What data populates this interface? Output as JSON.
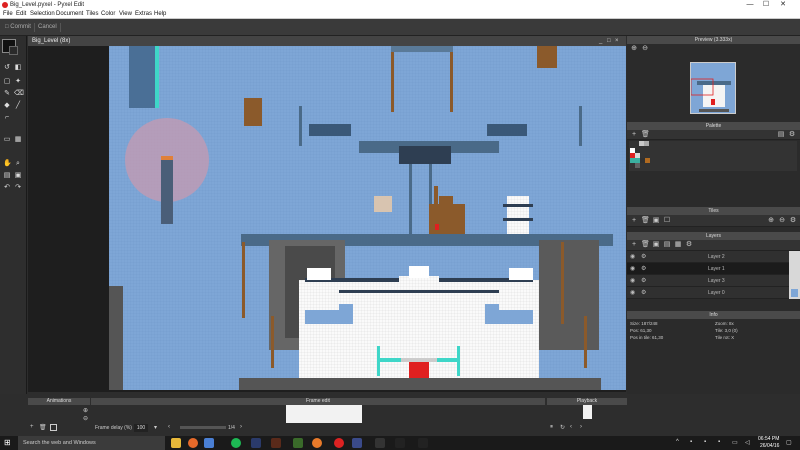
{
  "window": {
    "title": "Big_Level.pyxel - Pyxel Edit",
    "minimize": "—",
    "maximize": "☐",
    "close": "✕"
  },
  "menu": [
    "File",
    "Edit",
    "Selection",
    "Document",
    "Tiles",
    "Color",
    "View",
    "Extras",
    "Help"
  ],
  "toolbar": {
    "commit": "Commit",
    "cancel": "Cancel"
  },
  "colors": {
    "primary": "#111111",
    "secondary": "#2a2a2a",
    "background": "#7ea6d6"
  },
  "canvas": {
    "tab_label": "Big_Level (8x)",
    "minimize": "_",
    "maximize": "□",
    "close": "×"
  },
  "preview": {
    "title": "Preview (3.333x)"
  },
  "palette": {
    "title": "Palette",
    "swatches": [
      "#c8c8c8",
      "#ffffff",
      "#e02020",
      "#d8d8d8",
      "#3ab0a0",
      "#3ab0a0",
      "#b06a20",
      "#303030",
      "#505050",
      "#606060"
    ]
  },
  "tiles": {
    "title": "Tiles"
  },
  "layers": {
    "title": "Layers",
    "items": [
      {
        "name": "Layer 2",
        "selected": false
      },
      {
        "name": "Layer 1",
        "selected": true
      },
      {
        "name": "Layer 3",
        "selected": false
      },
      {
        "name": "Layer 0",
        "selected": false
      }
    ]
  },
  "info": {
    "title": "Info",
    "size": "Size: 187/248",
    "zoom": "Zoom: 8x",
    "pos": "Pos: 61,30",
    "tile": "Tile: 3,0 (0)",
    "pos_in_tile": "Pos in tile: 61,30",
    "tile_rot": "Tile rot: X"
  },
  "animations": {
    "title": "Animations",
    "frame_delay_label": "Frame delay (%)",
    "frame_delay_value": "100"
  },
  "frame_edit": {
    "title": "Frame edit",
    "counter": "1/4"
  },
  "playback": {
    "title": "Playback"
  },
  "taskbar": {
    "search": "Search the web and Windows",
    "time": "06:54 PM",
    "date": "26/04/16"
  }
}
